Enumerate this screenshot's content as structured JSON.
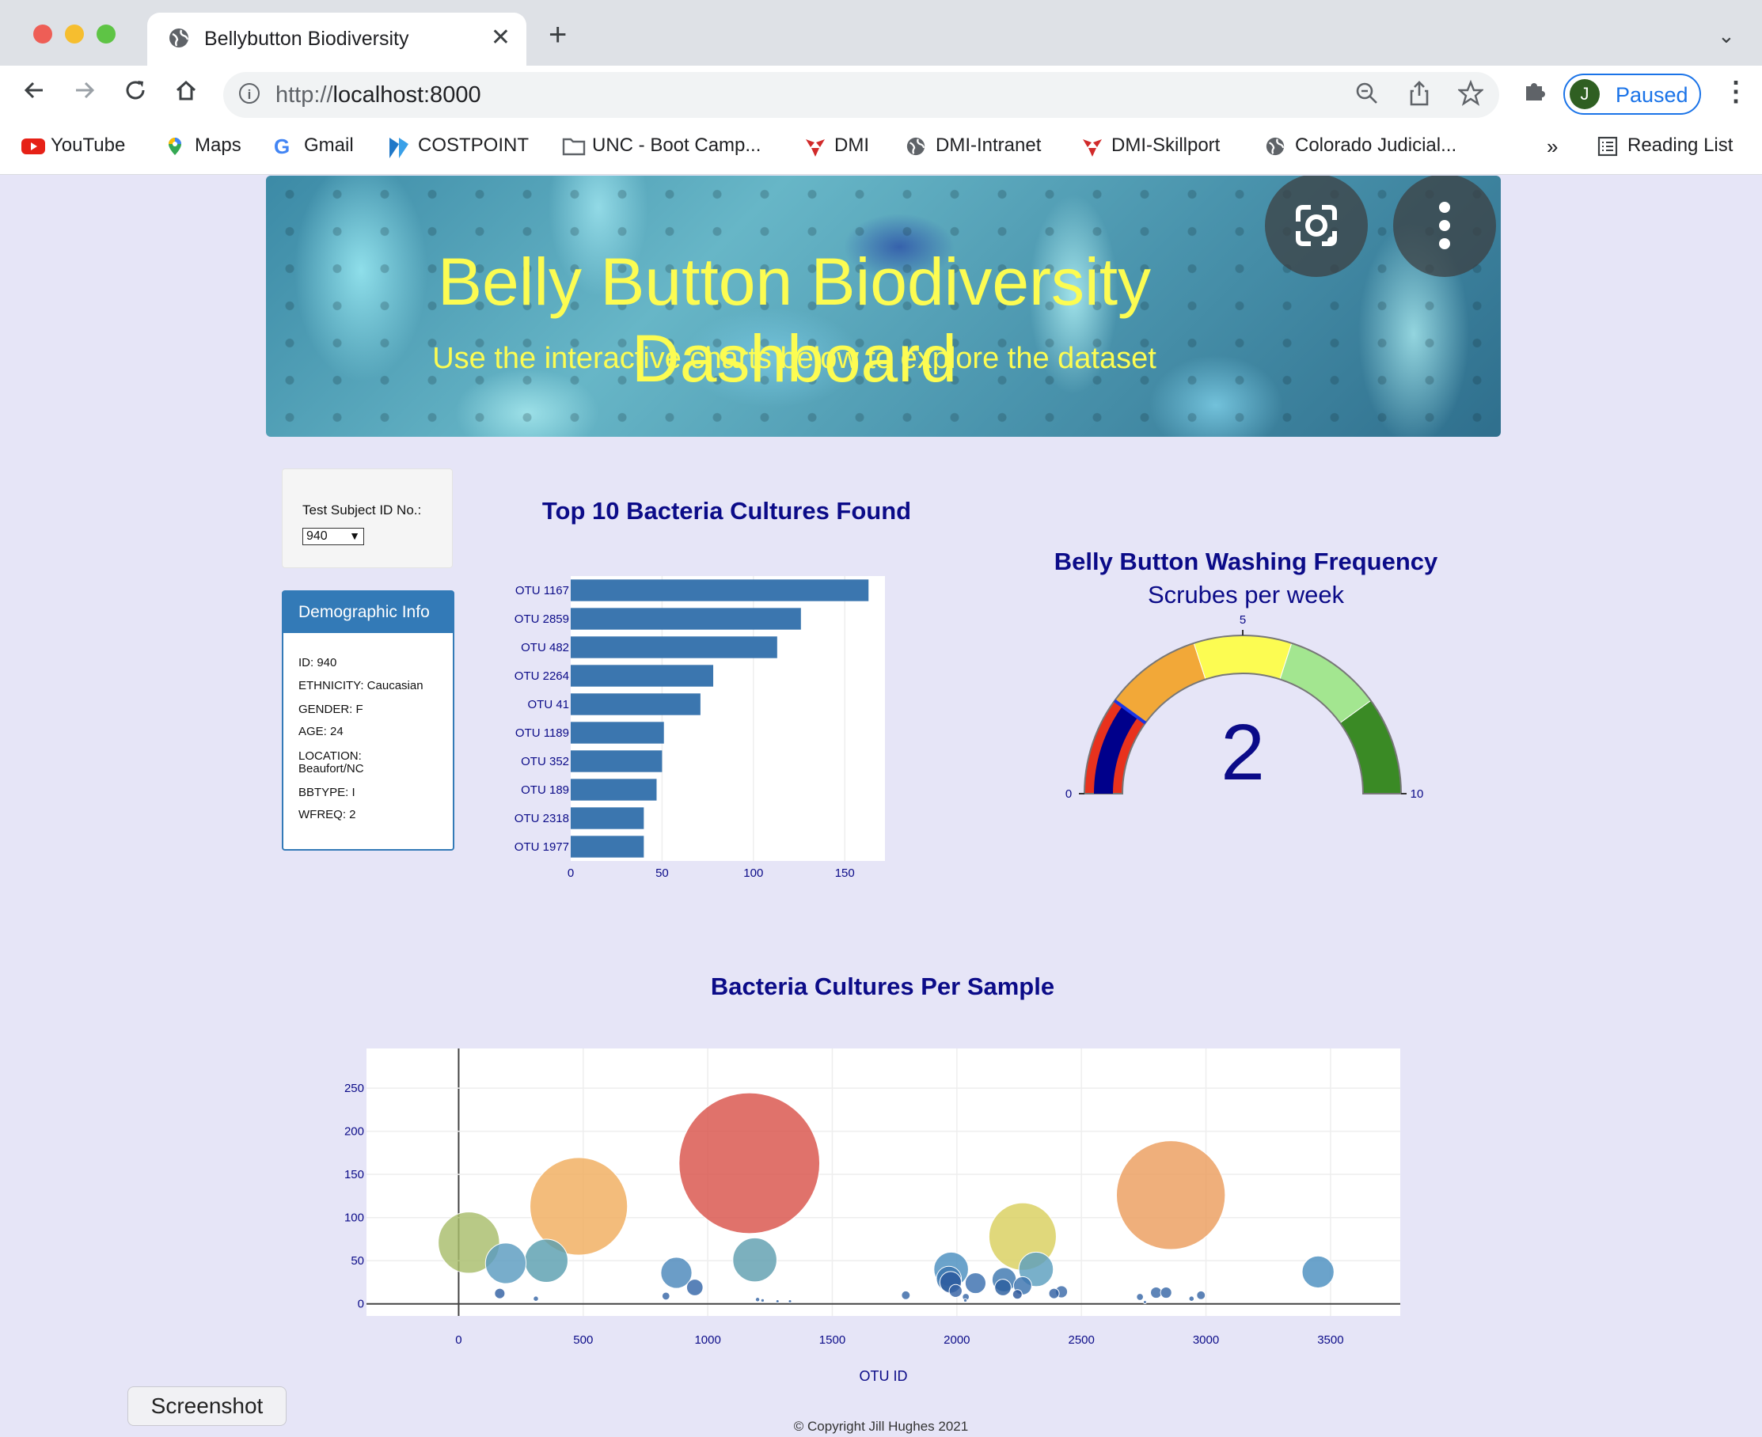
{
  "browser": {
    "tab_title": "Bellybutton Biodiversity",
    "url_prefix": "http://",
    "url_host": "localhost:8000",
    "profile_initial": "J",
    "profile_status": "Paused",
    "bookmarks": [
      {
        "label": "YouTube",
        "icon": "youtube-icon"
      },
      {
        "label": "Maps",
        "icon": "maps-icon"
      },
      {
        "label": "Gmail",
        "icon": "google-icon"
      },
      {
        "label": "COSTPOINT",
        "icon": "costpoint-icon"
      },
      {
        "label": "UNC - Boot Camp...",
        "icon": "folder-icon"
      },
      {
        "label": "DMI",
        "icon": "dmi-icon"
      },
      {
        "label": "DMI-Intranet",
        "icon": "globe-icon"
      },
      {
        "label": "DMI-Skillport",
        "icon": "dmi-icon"
      },
      {
        "label": "Colorado Judicial...",
        "icon": "globe-icon"
      }
    ],
    "bookmarks_overflow": "»",
    "reading_list": "Reading List"
  },
  "header": {
    "title": "Belly Button Biodiversity Dashboard",
    "subtitle": "Use the interactive charts below to explore the dataset"
  },
  "selector": {
    "label": "Test Subject ID No.:",
    "selected": "940"
  },
  "demographics": {
    "heading": "Demographic Info",
    "rows": [
      "ID: 940",
      "ETHNICITY: Caucasian",
      "GENDER: F",
      "AGE: 24",
      "LOCATION: Beaufort/NC",
      "BBTYPE: I",
      "WFREQ: 2"
    ]
  },
  "bar_title": "Top 10 Bacteria Cultures Found",
  "gauge_title": "Belly Button Washing Frequency",
  "gauge_subtitle": "Scrubes per week",
  "bubble_title": "Bacteria Cultures Per Sample",
  "footer": "© Copyright Jill Hughes 2021",
  "screenshot_button": "Screenshot",
  "colors": {
    "title": "#0b0b88",
    "banner_text": "#fcfc52",
    "bar": "#3b76af",
    "panel_header": "#337ab7"
  },
  "chart_data": [
    {
      "type": "bar",
      "orientation": "horizontal",
      "categories": [
        "OTU 1167",
        "OTU 2859",
        "OTU 482",
        "OTU 2264",
        "OTU 41",
        "OTU 1189",
        "OTU 352",
        "OTU 189",
        "OTU 2318",
        "OTU 1977"
      ],
      "values": [
        163,
        126,
        113,
        78,
        71,
        51,
        50,
        47,
        40,
        40
      ],
      "xlim": [
        0,
        172
      ],
      "xticks": [
        0,
        50,
        100,
        150
      ]
    },
    {
      "type": "gauge",
      "value": 2,
      "range": [
        0,
        10
      ],
      "ticks": [
        0,
        5,
        10
      ],
      "steps": [
        {
          "range": [
            0,
            2
          ],
          "color": "#e8321d"
        },
        {
          "range": [
            2,
            4
          ],
          "color": "#f2a838"
        },
        {
          "range": [
            4,
            6
          ],
          "color": "#fcfc52"
        },
        {
          "range": [
            6,
            8
          ],
          "color": "#a3e690"
        },
        {
          "range": [
            8,
            10
          ],
          "color": "#3a8a25"
        }
      ],
      "bar_color": "#00008b"
    },
    {
      "type": "scatter",
      "mode": "bubble",
      "xlabel": "OTU ID",
      "xlim": [
        -370,
        3780
      ],
      "ylim": [
        -14,
        296
      ],
      "xticks": [
        0,
        500,
        1000,
        1500,
        2000,
        2500,
        3000,
        3500
      ],
      "yticks": [
        0,
        50,
        100,
        150,
        200,
        250
      ],
      "points": [
        {
          "x": 41,
          "y": 71,
          "color": "#a8bd6b"
        },
        {
          "x": 189,
          "y": 47,
          "color": "#5a9bbf"
        },
        {
          "x": 352,
          "y": 50,
          "color": "#5a9fb0"
        },
        {
          "x": 482,
          "y": 113,
          "color": "#f0ad5e"
        },
        {
          "x": 1167,
          "y": 163,
          "color": "#d9534a"
        },
        {
          "x": 1189,
          "y": 51,
          "color": "#5f9fb0"
        },
        {
          "x": 2264,
          "y": 78,
          "color": "#d9cf5e"
        },
        {
          "x": 2859,
          "y": 126,
          "color": "#ec9d5e"
        },
        {
          "x": 2318,
          "y": 40,
          "color": "#5b9fbe"
        },
        {
          "x": 1977,
          "y": 40,
          "color": "#4b8fc0"
        },
        {
          "x": 3450,
          "y": 37,
          "color": "#4b8fbf"
        },
        {
          "x": 874,
          "y": 36,
          "color": "#4b88bb"
        },
        {
          "x": 948,
          "y": 19,
          "color": "#3566a8"
        },
        {
          "x": 1968,
          "y": 29,
          "color": "#3b75ae"
        },
        {
          "x": 2075,
          "y": 24,
          "color": "#3a6fae"
        },
        {
          "x": 2190,
          "y": 28,
          "color": "#3d78b0"
        },
        {
          "x": 2264,
          "y": 21,
          "color": "#3b73ae"
        },
        {
          "x": 2185,
          "y": 19,
          "color": "#2b5e9f"
        },
        {
          "x": 1975,
          "y": 25,
          "color": "#2c5a9d"
        },
        {
          "x": 1995,
          "y": 15,
          "color": "#3562a3"
        },
        {
          "x": 2243,
          "y": 11,
          "color": "#2b5698"
        },
        {
          "x": 2390,
          "y": 12,
          "color": "#3260a2"
        },
        {
          "x": 2420,
          "y": 14,
          "color": "#3a6aa8"
        },
        {
          "x": 2800,
          "y": 13,
          "color": "#3b6aa8"
        },
        {
          "x": 2840,
          "y": 13,
          "color": "#3766a6"
        },
        {
          "x": 2980,
          "y": 10,
          "color": "#3766a6"
        },
        {
          "x": 1795,
          "y": 10,
          "color": "#3766a6"
        },
        {
          "x": 832,
          "y": 9,
          "color": "#3766a6"
        },
        {
          "x": 165,
          "y": 12,
          "color": "#3260a2"
        },
        {
          "x": 2735,
          "y": 8,
          "color": "#3766a6"
        },
        {
          "x": 2942,
          "y": 6,
          "color": "#3766a6"
        },
        {
          "x": 2036,
          "y": 8,
          "color": "#3766a6"
        },
        {
          "x": 310,
          "y": 6,
          "color": "#3766a6"
        },
        {
          "x": 1200,
          "y": 5,
          "color": "#3766a6"
        },
        {
          "x": 1220,
          "y": 4,
          "color": "#3766a6"
        },
        {
          "x": 2034,
          "y": 4,
          "color": "#3766a6"
        },
        {
          "x": 1330,
          "y": 3,
          "color": "#3766a6"
        },
        {
          "x": 2755,
          "y": 2,
          "color": "#3766a6"
        },
        {
          "x": 1280,
          "y": 3,
          "color": "#3766a6"
        }
      ]
    }
  ]
}
